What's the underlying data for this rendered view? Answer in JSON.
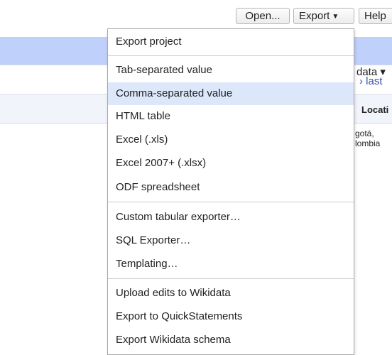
{
  "toolbar": {
    "open_label": "Open...",
    "export_label": "Export",
    "help_label": "Help"
  },
  "background": {
    "wikidata_menu": "data ▾",
    "last_link": "› last",
    "column_header": "Locati",
    "cell_text_line1": "gotá,",
    "cell_text_line2": "lombia"
  },
  "export_menu": {
    "items": [
      "Export project",
      "Tab-separated value",
      "Comma-separated value",
      "HTML table",
      "Excel (.xls)",
      "Excel 2007+ (.xlsx)",
      "ODF spreadsheet",
      "Custom tabular exporter…",
      "SQL Exporter…",
      "Templating…",
      "Upload edits to Wikidata",
      "Export to QuickStatements",
      "Export Wikidata schema"
    ],
    "highlighted_item": "Comma-separated value"
  },
  "colors": {
    "header_band": "#bfd0fb",
    "menu_highlight": "#dce7fa",
    "link": "#3850b5"
  }
}
